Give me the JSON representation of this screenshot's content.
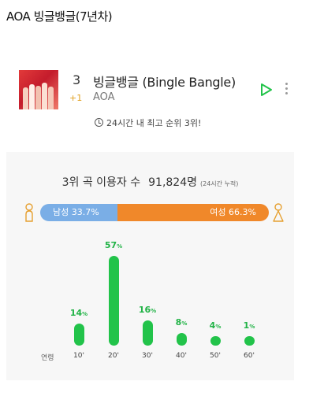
{
  "post_title": "AOA 빙글뱅글(7년차)",
  "song": {
    "rank": "3",
    "rank_change": "+1",
    "title": "빙글뱅글 (Bingle Bangle)",
    "artist": "AOA",
    "peak_note": "24시간 내 최고 순위 3위!",
    "icons": [
      "album-art",
      "play-icon",
      "more-icon",
      "clock-icon"
    ]
  },
  "stats": {
    "rank_label": "3위 곡 이용자 수",
    "listener_count": "91,824명",
    "period_note": "(24시간 누적)",
    "gender": {
      "male_label": "남성 33.7%",
      "female_label": "여성 66.3%",
      "male_share": 33.7,
      "female_share": 66.3,
      "male_color": "#7aaee6",
      "female_color": "#f0882a"
    },
    "age": {
      "axis_title": "연령",
      "max_pct": 57,
      "color": "#22c34a",
      "groups": [
        {
          "label": "10'",
          "pct_text": "14",
          "value": 14
        },
        {
          "label": "20'",
          "pct_text": "57",
          "value": 57
        },
        {
          "label": "30'",
          "pct_text": "16",
          "value": 16
        },
        {
          "label": "40'",
          "pct_text": "8",
          "value": 8
        },
        {
          "label": "50'",
          "pct_text": "4",
          "value": 4
        },
        {
          "label": "60'",
          "pct_text": "1",
          "value": 1
        }
      ],
      "pct_unit": "%"
    }
  }
}
